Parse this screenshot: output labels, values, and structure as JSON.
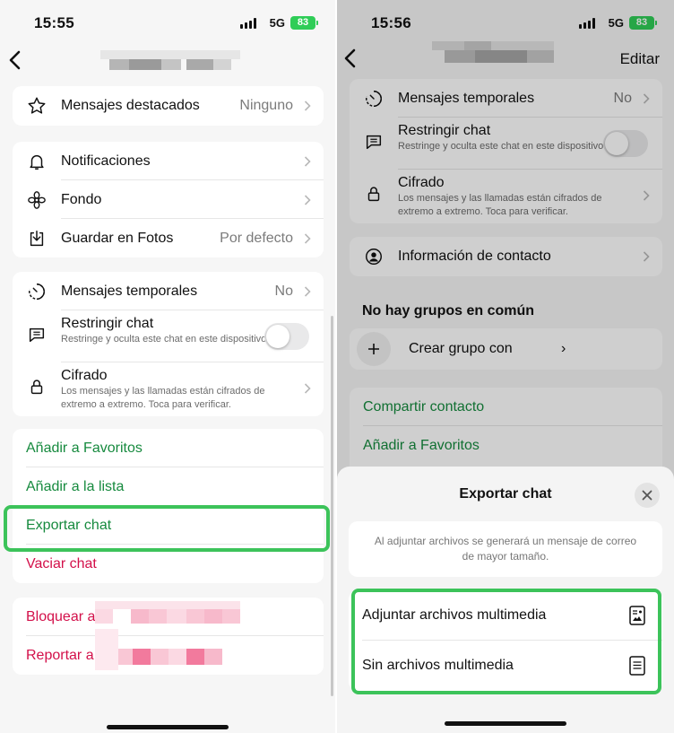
{
  "status_left": {
    "time": "15:55",
    "network": "5G",
    "battery": "83"
  },
  "status_right": {
    "time": "15:56",
    "network": "5G",
    "battery": "83"
  },
  "left": {
    "starred": {
      "label": "Mensajes destacados",
      "value": "Ninguno",
      "icon": "star-icon"
    },
    "notifications": {
      "label": "Notificaciones",
      "icon": "bell-icon"
    },
    "wallpaper": {
      "label": "Fondo",
      "icon": "flower-icon"
    },
    "save_photos": {
      "label": "Guardar en Fotos",
      "value": "Por defecto",
      "icon": "download-icon"
    },
    "disappearing": {
      "label": "Mensajes temporales",
      "value": "No",
      "icon": "timer-icon"
    },
    "restrict": {
      "label": "Restringir chat",
      "sub": "Restringe y oculta este chat en este dispositivo.",
      "icon": "chat-lock-icon"
    },
    "encryption": {
      "label": "Cifrado",
      "sub": "Los mensajes y las llamadas están cifrados de extremo a extremo. Toca para verificar.",
      "icon": "lock-icon"
    },
    "actions": {
      "favorites": "Añadir a Favoritos",
      "add_list": "Añadir a la lista",
      "export": "Exportar chat",
      "clear": "Vaciar chat"
    },
    "danger": {
      "block": "Bloquear a",
      "report": "Reportar a"
    }
  },
  "right": {
    "edit": "Editar",
    "disappearing": {
      "label": "Mensajes temporales",
      "value": "No"
    },
    "restrict": {
      "label": "Restringir chat",
      "sub": "Restringe y oculta este chat en este dispositivo."
    },
    "encryption": {
      "label": "Cifrado",
      "sub": "Los mensajes y las llamadas están cifrados de extremo a extremo. Toca para verificar."
    },
    "contact_info": {
      "label": "Información de contacto",
      "icon": "person-circle-icon"
    },
    "groups_header": "No hay grupos en común",
    "create_group": {
      "label": "Crear grupo con",
      "suffix": "›"
    },
    "share_contact": "Compartir contacto",
    "favorites": "Añadir a Favoritos",
    "sheet": {
      "title": "Exportar chat",
      "note": "Al adjuntar archivos se generará un mensaje de correo de mayor tamaño.",
      "options": [
        {
          "label": "Adjuntar archivos multimedia",
          "icon": "document-media-icon"
        },
        {
          "label": "Sin archivos multimedia",
          "icon": "document-text-icon"
        }
      ]
    }
  },
  "colors": {
    "accent_green": "#168a3e",
    "danger_red": "#d3104a",
    "highlight": "#3cc35a",
    "battery": "#2fcd57"
  }
}
